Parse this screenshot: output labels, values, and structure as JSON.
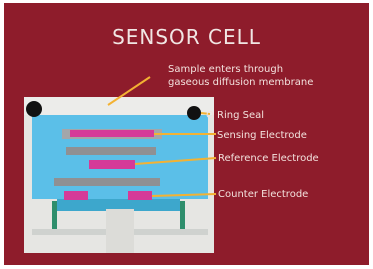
{
  "title": "SENSOR CELL",
  "labels": {
    "sample_line1": "Sample enters through",
    "sample_line2": "gaseous diffusion membrane",
    "o_ring": "O Ring Seal",
    "sensing": "Sensing Electrode",
    "reference": "Reference Electrode",
    "counter": "Counter Electrode"
  },
  "colors": {
    "background": "#8e1c2b",
    "body": "#e6e6e3",
    "electrolyte": "#5bbfe8",
    "electrode_pink": "#d63a98",
    "electrode_gray": "#8f9093",
    "leader_line": "#f3b233",
    "o_ring": "#111111",
    "stem": "#2e8e6c"
  }
}
